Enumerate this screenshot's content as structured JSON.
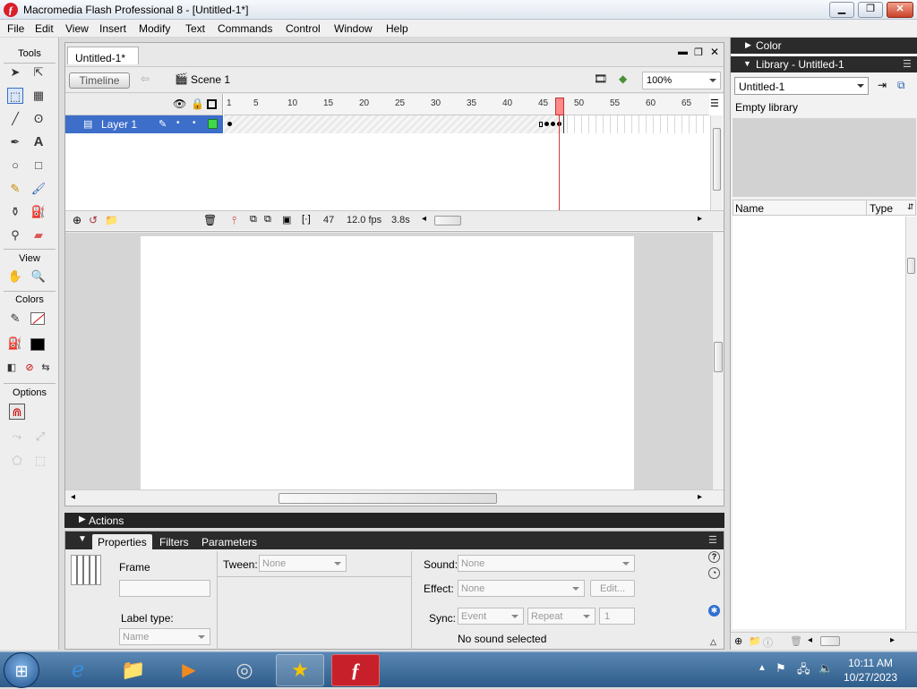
{
  "window": {
    "title": "Macromedia Flash Professional 8 - [Untitled-1*]",
    "min": "▁",
    "max": "❐",
    "close": "✕"
  },
  "menu": [
    "File",
    "Edit",
    "View",
    "Insert",
    "Modify",
    "Text",
    "Commands",
    "Control",
    "Window",
    "Help"
  ],
  "tools": {
    "title": "Tools",
    "view": "View",
    "colors": "Colors",
    "options": "Options"
  },
  "document": {
    "tab": "Untitled-1*",
    "timeline_button": "Timeline",
    "scene": "Scene 1",
    "zoom": "100%",
    "layer_name": "Layer 1",
    "ruler_ticks": [
      "1",
      "5",
      "10",
      "15",
      "20",
      "25",
      "30",
      "35",
      "40",
      "45",
      "50",
      "55",
      "60",
      "65"
    ],
    "frame_number": "47",
    "fps": "12.0 fps",
    "time": "3.8s"
  },
  "actions": {
    "label": "Actions"
  },
  "properties": {
    "tabs": [
      "Properties",
      "Filters",
      "Parameters"
    ],
    "frame_label": "Frame",
    "tween_label": "Tween:",
    "tween_value": "None",
    "label_type": "Label type:",
    "label_type_value": "Name",
    "sound_label": "Sound:",
    "sound_value": "None",
    "effect_label": "Effect:",
    "effect_value": "None",
    "edit_button": "Edit...",
    "sync_label": "Sync:",
    "sync_value": "Event",
    "repeat_value": "Repeat",
    "repeat_count": "1",
    "sound_status": "No sound selected"
  },
  "panels": {
    "color_title": "Color",
    "library_title": "Library - Untitled-1",
    "library_select": "Untitled-1",
    "library_status": "Empty library",
    "col_name": "Name",
    "col_type": "Type"
  },
  "taskbar": {
    "time": "10:11 AM",
    "date": "10/27/2023"
  }
}
